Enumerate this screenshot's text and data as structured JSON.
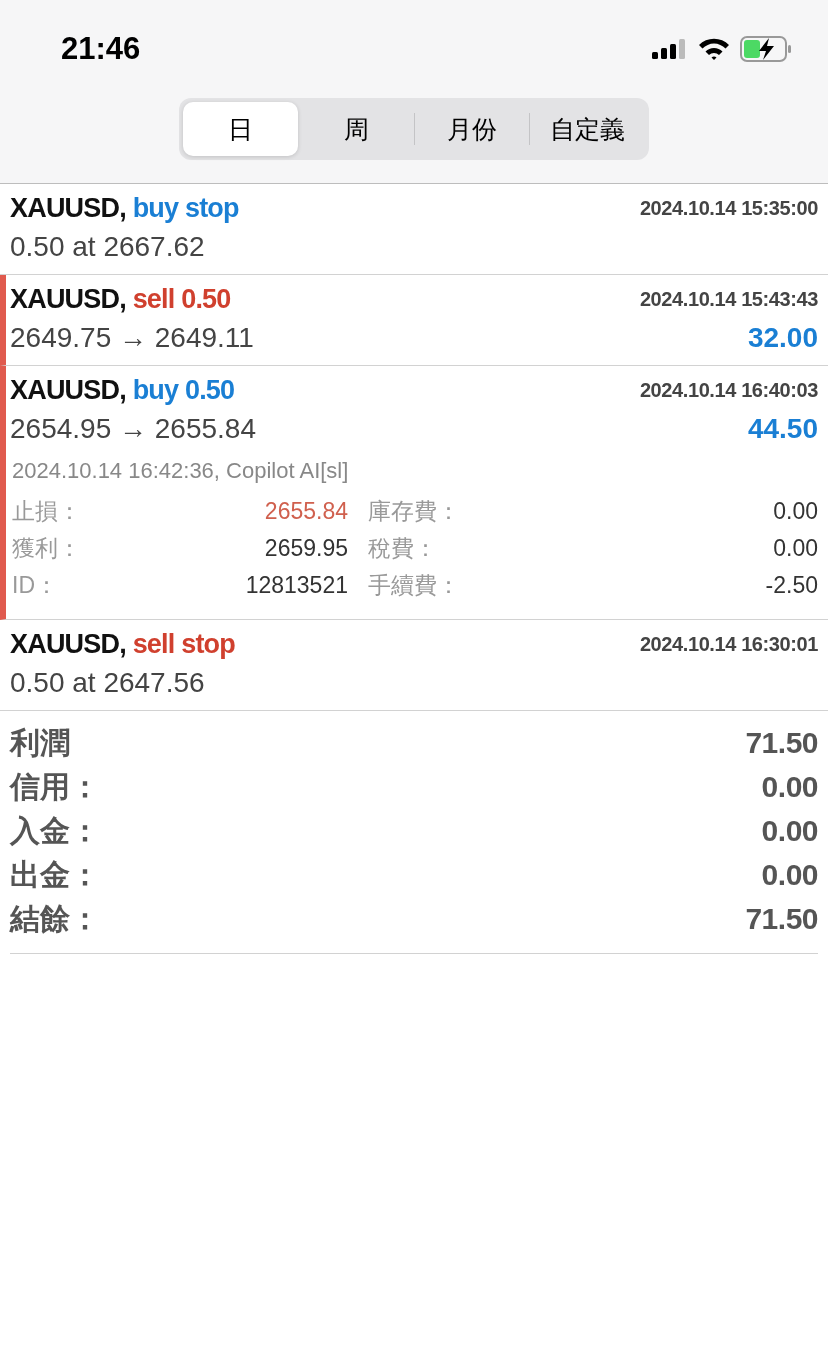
{
  "status_bar": {
    "time": "21:46"
  },
  "tabs": [
    {
      "label": "日",
      "selected": true
    },
    {
      "label": "周",
      "selected": false
    },
    {
      "label": "月份",
      "selected": false
    },
    {
      "label": "自定義",
      "selected": false
    }
  ],
  "trades": [
    {
      "kind": "order",
      "symbol": "XAUUSD,",
      "color": "#1a7fd4",
      "action": "buy stop",
      "time": "2024.10.14 15:35:00",
      "detail": "0.50 at 2667.62",
      "expanded": false
    },
    {
      "kind": "deal",
      "symbol": "XAUUSD,",
      "color": "#d0402e",
      "action": "sell 0.50",
      "time": "2024.10.14 15:43:43",
      "detail": "2649.75 → 2649.11",
      "profit": "32.00",
      "expanded": false
    },
    {
      "kind": "deal",
      "symbol": "XAUUSD,",
      "color": "#1a7fd4",
      "action": "buy 0.50",
      "time": "2024.10.14 16:40:03",
      "detail": "2654.95 → 2655.84",
      "profit": "44.50",
      "expanded": true,
      "close_info": "2024.10.14 16:42:36, Copilot AI[sl]",
      "fields": [
        [
          {
            "label": "止損：",
            "value": "2655.84",
            "highlighted": true
          },
          {
            "label": "庫存費：",
            "value": "0.00",
            "highlighted": false
          }
        ],
        [
          {
            "label": "獲利：",
            "value": "2659.95",
            "highlighted": false
          },
          {
            "label": "稅費：",
            "value": "0.00",
            "highlighted": false
          }
        ],
        [
          {
            "label": "ID：",
            "value": "12813521",
            "highlighted": false
          },
          {
            "label": "手續費：",
            "value": "-2.50",
            "highlighted": false
          }
        ]
      ]
    },
    {
      "kind": "order",
      "symbol": "XAUUSD,",
      "color": "#d0402e",
      "action": "sell stop",
      "time": "2024.10.14 16:30:01",
      "detail": "0.50 at 2647.56",
      "expanded": false
    }
  ],
  "summary": [
    {
      "label": "利潤",
      "value": "71.50"
    },
    {
      "label": "信用：",
      "value": "0.00"
    },
    {
      "label": "入金：",
      "value": "0.00"
    },
    {
      "label": "出金：",
      "value": "0.00"
    },
    {
      "label": "結餘：",
      "value": "71.50"
    }
  ]
}
